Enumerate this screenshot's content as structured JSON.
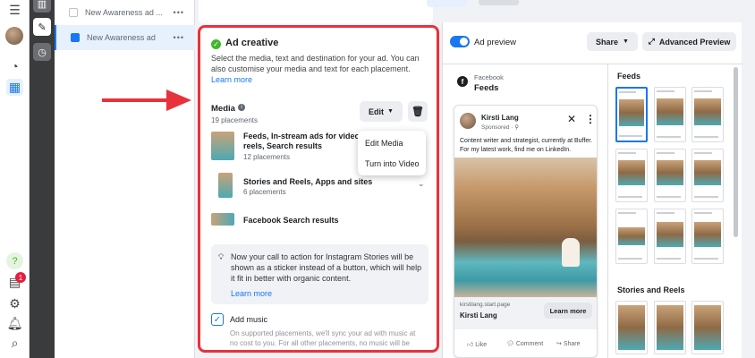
{
  "tree": {
    "items": [
      {
        "label": "New Awareness ad ..."
      },
      {
        "label": "New Awareness ad"
      }
    ]
  },
  "editor": {
    "section_title": "Ad creative",
    "description": "Select the media, text and destination for your ad. You can also customise your media and text for each placement.",
    "learn_more": "Learn more",
    "media_label": "Media",
    "placements_count": "19 placements",
    "edit_label": "Edit",
    "menu": [
      "Edit Media",
      "Turn into Video"
    ],
    "rows": [
      {
        "title_line1": "Feeds, In-stream ads for videos and",
        "title_line2": "reels, Search results",
        "sub": "12 placements"
      },
      {
        "title": "Stories and Reels, Apps and sites",
        "sub": "6 placements"
      },
      {
        "title": "Facebook Search results",
        "sub": ""
      }
    ],
    "notice": "Now your call to action for Instagram Stories will be shown as a sticker instead of a button, which will help it fit in better with organic content.",
    "notice_link": "Learn more",
    "music_label": "Add music",
    "music_desc": "On supported placements, we'll sync your ad with music at no cost to you. For all other placements, no music will be added."
  },
  "preview": {
    "toggle_label": "Ad preview",
    "share_label": "Share",
    "advanced_label": "Advanced Preview",
    "platform": "Facebook",
    "placement": "Feeds",
    "post": {
      "name": "Kirsti Lang",
      "meta": "Sponsored · ⚲",
      "text": "Content writer and strategist, currently at Buffer. For my latest work, find me on LinkedIn.",
      "domain": "kirstilang.start.page",
      "title": "Kirsti Lang",
      "cta": "Learn more",
      "actions": [
        "Like",
        "Comment",
        "Share"
      ]
    },
    "feeds_heading": "Feeds",
    "stories_heading": "Stories and Reels"
  },
  "colors": {
    "accent": "#1877f2",
    "highlight": "#e8323b",
    "success": "#42b72a"
  },
  "badge_count": "1"
}
